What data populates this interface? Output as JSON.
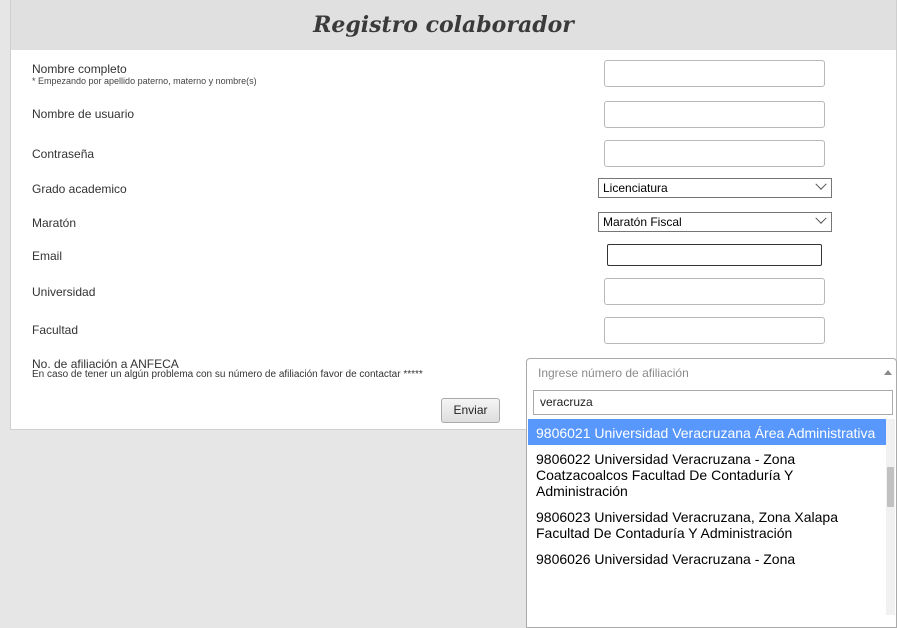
{
  "form": {
    "title": "Registro colaborador",
    "fields": {
      "nombre_completo": {
        "label": "Nombre completo",
        "hint": "* Empezando por apellido paterno, materno y nombre(s)",
        "value": ""
      },
      "usuario": {
        "label": "Nombre de usuario",
        "value": ""
      },
      "contrasena": {
        "label": "Contraseña",
        "value": ""
      },
      "grado": {
        "label": "Grado academico",
        "selected": "Licenciatura"
      },
      "maraton": {
        "label": "Maratón",
        "selected": "Maratón Fiscal"
      },
      "email": {
        "label": "Email",
        "value": ""
      },
      "universidad": {
        "label": "Universidad",
        "value": ""
      },
      "facultad": {
        "label": "Facultad",
        "value": ""
      },
      "afiliacion": {
        "label": "No. de afiliación a ANFECA",
        "hint": "En caso de tener un algún problema con su número de afiliación favor de contactar *****",
        "placeholder": "Ingrese número de afiliación"
      }
    },
    "submit_label": "Enviar"
  },
  "dropdown": {
    "search_value": "veracruza",
    "options": [
      "9806021 Universidad Veracruzana Área Administrativa",
      "9806022 Universidad Veracruzana - Zona Coatzacoalcos Facultad De Contaduría Y Administración",
      "9806023 Universidad Veracruzana, Zona Xalapa  Facultad De Contaduría Y Administración",
      "9806026 Universidad Veracruzana - Zona"
    ],
    "highlighted_index": 0
  },
  "colors": {
    "highlight": "#5897fb",
    "page_background": "#e6e6e6",
    "header_background": "#e0e0e0"
  }
}
